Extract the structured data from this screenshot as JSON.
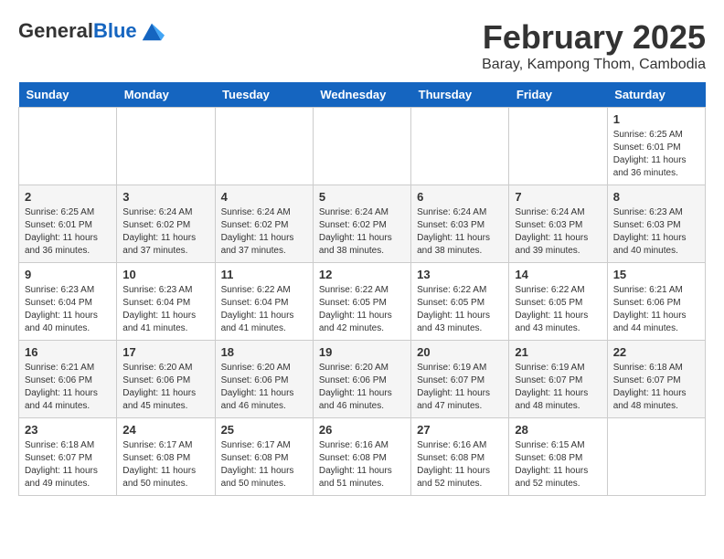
{
  "header": {
    "logo_general": "General",
    "logo_blue": "Blue",
    "title": "February 2025",
    "subtitle": "Baray, Kampong Thom, Cambodia"
  },
  "days_of_week": [
    "Sunday",
    "Monday",
    "Tuesday",
    "Wednesday",
    "Thursday",
    "Friday",
    "Saturday"
  ],
  "weeks": [
    [
      {
        "day": "",
        "info": ""
      },
      {
        "day": "",
        "info": ""
      },
      {
        "day": "",
        "info": ""
      },
      {
        "day": "",
        "info": ""
      },
      {
        "day": "",
        "info": ""
      },
      {
        "day": "",
        "info": ""
      },
      {
        "day": "1",
        "info": "Sunrise: 6:25 AM\nSunset: 6:01 PM\nDaylight: 11 hours\nand 36 minutes."
      }
    ],
    [
      {
        "day": "2",
        "info": "Sunrise: 6:25 AM\nSunset: 6:01 PM\nDaylight: 11 hours\nand 36 minutes."
      },
      {
        "day": "3",
        "info": "Sunrise: 6:24 AM\nSunset: 6:02 PM\nDaylight: 11 hours\nand 37 minutes."
      },
      {
        "day": "4",
        "info": "Sunrise: 6:24 AM\nSunset: 6:02 PM\nDaylight: 11 hours\nand 37 minutes."
      },
      {
        "day": "5",
        "info": "Sunrise: 6:24 AM\nSunset: 6:02 PM\nDaylight: 11 hours\nand 38 minutes."
      },
      {
        "day": "6",
        "info": "Sunrise: 6:24 AM\nSunset: 6:03 PM\nDaylight: 11 hours\nand 38 minutes."
      },
      {
        "day": "7",
        "info": "Sunrise: 6:24 AM\nSunset: 6:03 PM\nDaylight: 11 hours\nand 39 minutes."
      },
      {
        "day": "8",
        "info": "Sunrise: 6:23 AM\nSunset: 6:03 PM\nDaylight: 11 hours\nand 40 minutes."
      }
    ],
    [
      {
        "day": "9",
        "info": "Sunrise: 6:23 AM\nSunset: 6:04 PM\nDaylight: 11 hours\nand 40 minutes."
      },
      {
        "day": "10",
        "info": "Sunrise: 6:23 AM\nSunset: 6:04 PM\nDaylight: 11 hours\nand 41 minutes."
      },
      {
        "day": "11",
        "info": "Sunrise: 6:22 AM\nSunset: 6:04 PM\nDaylight: 11 hours\nand 41 minutes."
      },
      {
        "day": "12",
        "info": "Sunrise: 6:22 AM\nSunset: 6:05 PM\nDaylight: 11 hours\nand 42 minutes."
      },
      {
        "day": "13",
        "info": "Sunrise: 6:22 AM\nSunset: 6:05 PM\nDaylight: 11 hours\nand 43 minutes."
      },
      {
        "day": "14",
        "info": "Sunrise: 6:22 AM\nSunset: 6:05 PM\nDaylight: 11 hours\nand 43 minutes."
      },
      {
        "day": "15",
        "info": "Sunrise: 6:21 AM\nSunset: 6:06 PM\nDaylight: 11 hours\nand 44 minutes."
      }
    ],
    [
      {
        "day": "16",
        "info": "Sunrise: 6:21 AM\nSunset: 6:06 PM\nDaylight: 11 hours\nand 44 minutes."
      },
      {
        "day": "17",
        "info": "Sunrise: 6:20 AM\nSunset: 6:06 PM\nDaylight: 11 hours\nand 45 minutes."
      },
      {
        "day": "18",
        "info": "Sunrise: 6:20 AM\nSunset: 6:06 PM\nDaylight: 11 hours\nand 46 minutes."
      },
      {
        "day": "19",
        "info": "Sunrise: 6:20 AM\nSunset: 6:06 PM\nDaylight: 11 hours\nand 46 minutes."
      },
      {
        "day": "20",
        "info": "Sunrise: 6:19 AM\nSunset: 6:07 PM\nDaylight: 11 hours\nand 47 minutes."
      },
      {
        "day": "21",
        "info": "Sunrise: 6:19 AM\nSunset: 6:07 PM\nDaylight: 11 hours\nand 48 minutes."
      },
      {
        "day": "22",
        "info": "Sunrise: 6:18 AM\nSunset: 6:07 PM\nDaylight: 11 hours\nand 48 minutes."
      }
    ],
    [
      {
        "day": "23",
        "info": "Sunrise: 6:18 AM\nSunset: 6:07 PM\nDaylight: 11 hours\nand 49 minutes."
      },
      {
        "day": "24",
        "info": "Sunrise: 6:17 AM\nSunset: 6:08 PM\nDaylight: 11 hours\nand 50 minutes."
      },
      {
        "day": "25",
        "info": "Sunrise: 6:17 AM\nSunset: 6:08 PM\nDaylight: 11 hours\nand 50 minutes."
      },
      {
        "day": "26",
        "info": "Sunrise: 6:16 AM\nSunset: 6:08 PM\nDaylight: 11 hours\nand 51 minutes."
      },
      {
        "day": "27",
        "info": "Sunrise: 6:16 AM\nSunset: 6:08 PM\nDaylight: 11 hours\nand 52 minutes."
      },
      {
        "day": "28",
        "info": "Sunrise: 6:15 AM\nSunset: 6:08 PM\nDaylight: 11 hours\nand 52 minutes."
      },
      {
        "day": "",
        "info": ""
      }
    ]
  ]
}
